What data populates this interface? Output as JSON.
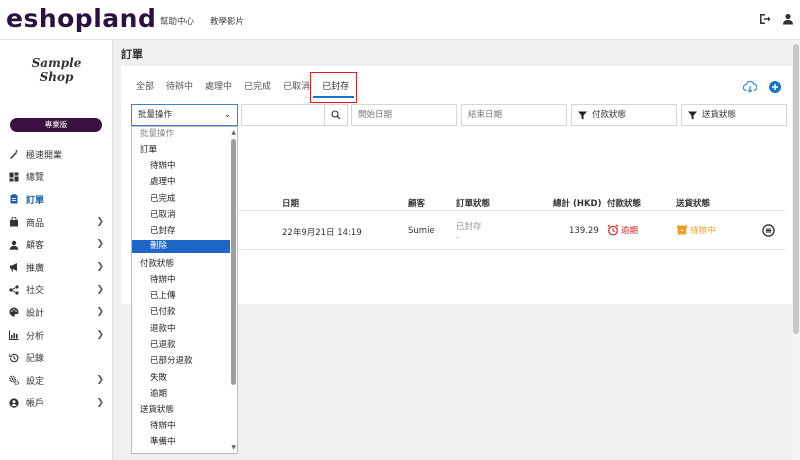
{
  "header": {
    "logo": "eshopland",
    "nav": [
      "幫助中心",
      "教學影片"
    ],
    "icons": [
      "logout-icon",
      "user-icon"
    ]
  },
  "sidebar": {
    "shop_logo_line1": "Sample",
    "shop_logo_line2": "Shop",
    "plan": "專業版",
    "items": [
      {
        "label": "極速開業",
        "icon": "magic-wand-icon",
        "has_children": false
      },
      {
        "label": "總覽",
        "icon": "dashboard-icon",
        "has_children": false
      },
      {
        "label": "訂單",
        "icon": "orders-icon",
        "has_children": false,
        "active": true
      },
      {
        "label": "商品",
        "icon": "product-icon",
        "has_children": true
      },
      {
        "label": "顧客",
        "icon": "user-icon",
        "has_children": true
      },
      {
        "label": "推廣",
        "icon": "megaphone-icon",
        "has_children": true
      },
      {
        "label": "社交",
        "icon": "share-icon",
        "has_children": true
      },
      {
        "label": "設計",
        "icon": "palette-icon",
        "has_children": true
      },
      {
        "label": "分析",
        "icon": "chart-icon",
        "has_children": true
      },
      {
        "label": "記錄",
        "icon": "history-icon",
        "has_children": false
      },
      {
        "label": "設定",
        "icon": "gears-icon",
        "has_children": true
      },
      {
        "label": "帳戶",
        "icon": "account-icon",
        "has_children": true
      }
    ]
  },
  "page": {
    "title": "訂單",
    "tabs": [
      "全部",
      "待辦中",
      "處理中",
      "已完成",
      "已取消",
      "已封存"
    ],
    "active_tab": "已封存"
  },
  "filters": {
    "bulk_action": "批量操作",
    "search_value": "",
    "start_date_placeholder": "開始日期",
    "end_date_placeholder": "結束日期",
    "payment_status": "付款狀態",
    "shipping_status": "送貨狀態"
  },
  "table": {
    "headers": {
      "date": "日期",
      "customer": "顧客",
      "order_status": "訂單狀態",
      "total": "總計 (HKD)",
      "payment_status": "付款狀態",
      "shipping_status": "送貨狀態"
    },
    "rows": [
      {
        "date": "22年9月21日 14:19",
        "customer": "Sumie",
        "order_status": "已封存",
        "order_status_sub": "-",
        "total": "139.29",
        "payment_status": "逾期",
        "shipping_status": "待辦中"
      }
    ]
  },
  "dropdown": {
    "items": [
      {
        "label": "批量操作",
        "type": "placeholder"
      },
      {
        "label": "訂單",
        "type": "group"
      },
      {
        "label": "待辦中",
        "type": "option"
      },
      {
        "label": "處理中",
        "type": "option"
      },
      {
        "label": "已完成",
        "type": "option"
      },
      {
        "label": "已取消",
        "type": "option"
      },
      {
        "label": "已封存",
        "type": "option"
      },
      {
        "label": "刪除",
        "type": "option",
        "selected": true
      },
      {
        "label": "付款狀態",
        "type": "group"
      },
      {
        "label": "待辦中",
        "type": "option"
      },
      {
        "label": "已上傳",
        "type": "option"
      },
      {
        "label": "已付款",
        "type": "option"
      },
      {
        "label": "退款中",
        "type": "option"
      },
      {
        "label": "已退款",
        "type": "option"
      },
      {
        "label": "已部分退款",
        "type": "option"
      },
      {
        "label": "失敗",
        "type": "option"
      },
      {
        "label": "逾期",
        "type": "option"
      },
      {
        "label": "送貨狀態",
        "type": "group"
      },
      {
        "label": "待辦中",
        "type": "option"
      },
      {
        "label": "準備中",
        "type": "option"
      }
    ]
  },
  "colors": {
    "brand": "#2b1040",
    "accent": "#1a73c8",
    "selected": "#1f66c9",
    "overdue": "#dd2222",
    "pending": "#f0a020",
    "highlight": "#e31b23"
  }
}
